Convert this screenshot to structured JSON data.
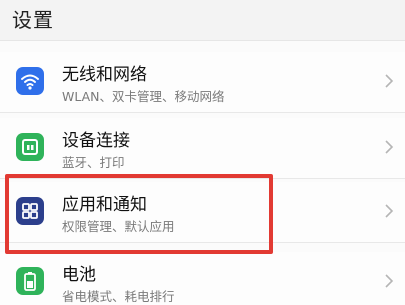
{
  "header": {
    "title": "设置"
  },
  "items": [
    {
      "title": "无线和网络",
      "subtitle": "WLAN、双卡管理、移动网络",
      "icon": "wifi-icon",
      "icon_color": "#2f6fea"
    },
    {
      "title": "设备连接",
      "subtitle": "蓝牙、打印",
      "icon": "device-connection-icon",
      "icon_color": "#2fb35a"
    },
    {
      "title": "应用和通知",
      "subtitle": "权限管理、默认应用",
      "icon": "apps-icon",
      "icon_color": "#2c3f8c"
    },
    {
      "title": "电池",
      "subtitle": "省电模式、耗电排行",
      "icon": "battery-icon",
      "icon_color": "#2fb35a"
    }
  ],
  "highlight_color": "#e23a33"
}
